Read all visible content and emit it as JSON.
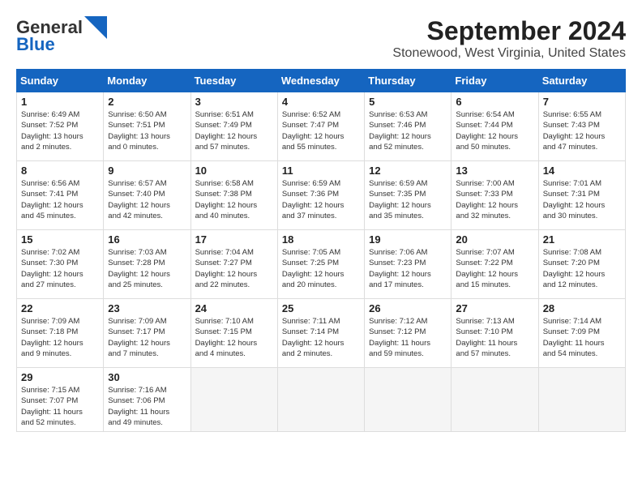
{
  "header": {
    "logo_line1": "General",
    "logo_line2": "Blue",
    "title": "September 2024",
    "subtitle": "Stonewood, West Virginia, United States"
  },
  "days_of_week": [
    "Sunday",
    "Monday",
    "Tuesday",
    "Wednesday",
    "Thursday",
    "Friday",
    "Saturday"
  ],
  "weeks": [
    [
      {
        "day": "1",
        "info": "Sunrise: 6:49 AM\nSunset: 7:52 PM\nDaylight: 13 hours\nand 2 minutes."
      },
      {
        "day": "2",
        "info": "Sunrise: 6:50 AM\nSunset: 7:51 PM\nDaylight: 13 hours\nand 0 minutes."
      },
      {
        "day": "3",
        "info": "Sunrise: 6:51 AM\nSunset: 7:49 PM\nDaylight: 12 hours\nand 57 minutes."
      },
      {
        "day": "4",
        "info": "Sunrise: 6:52 AM\nSunset: 7:47 PM\nDaylight: 12 hours\nand 55 minutes."
      },
      {
        "day": "5",
        "info": "Sunrise: 6:53 AM\nSunset: 7:46 PM\nDaylight: 12 hours\nand 52 minutes."
      },
      {
        "day": "6",
        "info": "Sunrise: 6:54 AM\nSunset: 7:44 PM\nDaylight: 12 hours\nand 50 minutes."
      },
      {
        "day": "7",
        "info": "Sunrise: 6:55 AM\nSunset: 7:43 PM\nDaylight: 12 hours\nand 47 minutes."
      }
    ],
    [
      {
        "day": "8",
        "info": "Sunrise: 6:56 AM\nSunset: 7:41 PM\nDaylight: 12 hours\nand 45 minutes."
      },
      {
        "day": "9",
        "info": "Sunrise: 6:57 AM\nSunset: 7:40 PM\nDaylight: 12 hours\nand 42 minutes."
      },
      {
        "day": "10",
        "info": "Sunrise: 6:58 AM\nSunset: 7:38 PM\nDaylight: 12 hours\nand 40 minutes."
      },
      {
        "day": "11",
        "info": "Sunrise: 6:59 AM\nSunset: 7:36 PM\nDaylight: 12 hours\nand 37 minutes."
      },
      {
        "day": "12",
        "info": "Sunrise: 6:59 AM\nSunset: 7:35 PM\nDaylight: 12 hours\nand 35 minutes."
      },
      {
        "day": "13",
        "info": "Sunrise: 7:00 AM\nSunset: 7:33 PM\nDaylight: 12 hours\nand 32 minutes."
      },
      {
        "day": "14",
        "info": "Sunrise: 7:01 AM\nSunset: 7:31 PM\nDaylight: 12 hours\nand 30 minutes."
      }
    ],
    [
      {
        "day": "15",
        "info": "Sunrise: 7:02 AM\nSunset: 7:30 PM\nDaylight: 12 hours\nand 27 minutes."
      },
      {
        "day": "16",
        "info": "Sunrise: 7:03 AM\nSunset: 7:28 PM\nDaylight: 12 hours\nand 25 minutes."
      },
      {
        "day": "17",
        "info": "Sunrise: 7:04 AM\nSunset: 7:27 PM\nDaylight: 12 hours\nand 22 minutes."
      },
      {
        "day": "18",
        "info": "Sunrise: 7:05 AM\nSunset: 7:25 PM\nDaylight: 12 hours\nand 20 minutes."
      },
      {
        "day": "19",
        "info": "Sunrise: 7:06 AM\nSunset: 7:23 PM\nDaylight: 12 hours\nand 17 minutes."
      },
      {
        "day": "20",
        "info": "Sunrise: 7:07 AM\nSunset: 7:22 PM\nDaylight: 12 hours\nand 15 minutes."
      },
      {
        "day": "21",
        "info": "Sunrise: 7:08 AM\nSunset: 7:20 PM\nDaylight: 12 hours\nand 12 minutes."
      }
    ],
    [
      {
        "day": "22",
        "info": "Sunrise: 7:09 AM\nSunset: 7:18 PM\nDaylight: 12 hours\nand 9 minutes."
      },
      {
        "day": "23",
        "info": "Sunrise: 7:09 AM\nSunset: 7:17 PM\nDaylight: 12 hours\nand 7 minutes."
      },
      {
        "day": "24",
        "info": "Sunrise: 7:10 AM\nSunset: 7:15 PM\nDaylight: 12 hours\nand 4 minutes."
      },
      {
        "day": "25",
        "info": "Sunrise: 7:11 AM\nSunset: 7:14 PM\nDaylight: 12 hours\nand 2 minutes."
      },
      {
        "day": "26",
        "info": "Sunrise: 7:12 AM\nSunset: 7:12 PM\nDaylight: 11 hours\nand 59 minutes."
      },
      {
        "day": "27",
        "info": "Sunrise: 7:13 AM\nSunset: 7:10 PM\nDaylight: 11 hours\nand 57 minutes."
      },
      {
        "day": "28",
        "info": "Sunrise: 7:14 AM\nSunset: 7:09 PM\nDaylight: 11 hours\nand 54 minutes."
      }
    ],
    [
      {
        "day": "29",
        "info": "Sunrise: 7:15 AM\nSunset: 7:07 PM\nDaylight: 11 hours\nand 52 minutes."
      },
      {
        "day": "30",
        "info": "Sunrise: 7:16 AM\nSunset: 7:06 PM\nDaylight: 11 hours\nand 49 minutes."
      },
      {
        "day": "",
        "info": ""
      },
      {
        "day": "",
        "info": ""
      },
      {
        "day": "",
        "info": ""
      },
      {
        "day": "",
        "info": ""
      },
      {
        "day": "",
        "info": ""
      }
    ]
  ]
}
